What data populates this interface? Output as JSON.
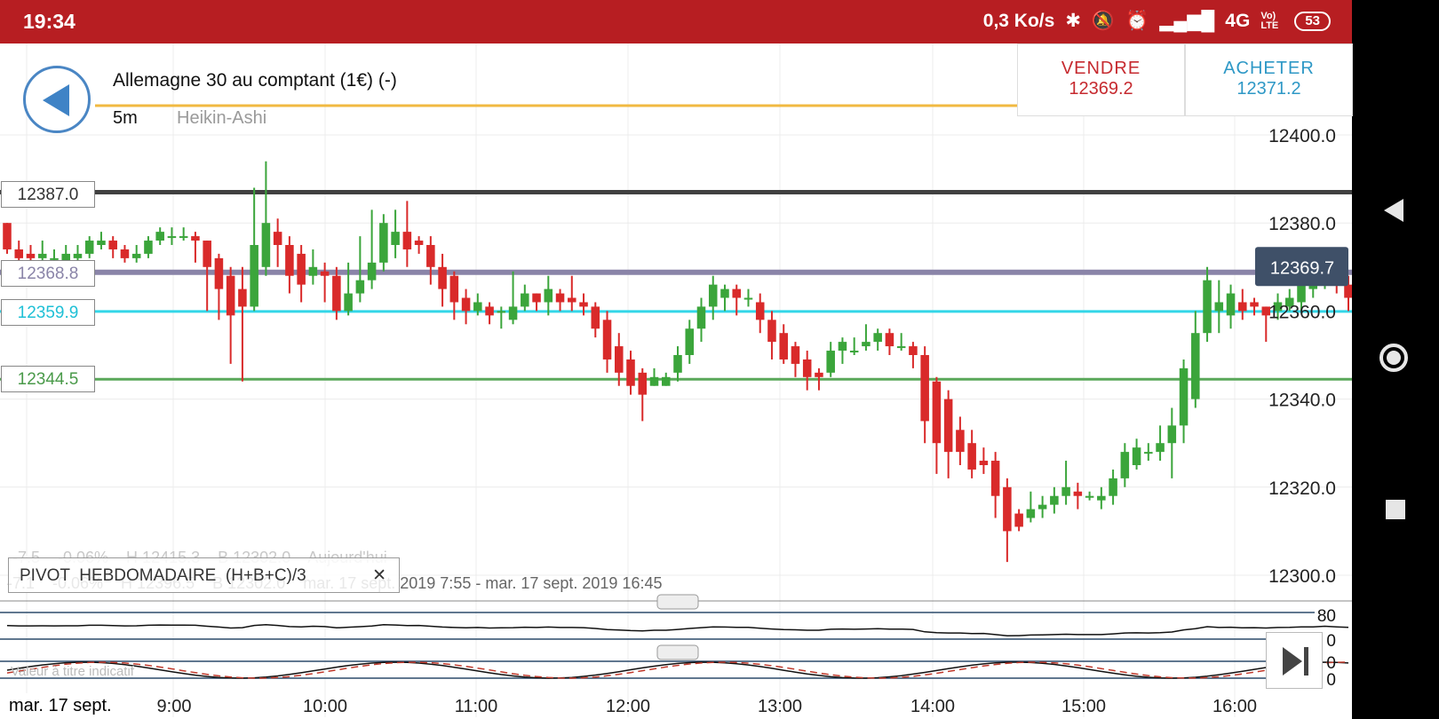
{
  "status_bar": {
    "time": "19:34",
    "net_speed": "0,3 Ko/s",
    "network": "4G",
    "volte": "Vo) LTE",
    "battery": "53"
  },
  "header": {
    "instrument": "Allemagne 30 au comptant (1€) (-)",
    "timeframe": "5m",
    "chart_type": "Heikin-Ashi"
  },
  "trade": {
    "sell_label": "VENDRE",
    "sell_price": "12369.2",
    "buy_label": "ACHETER",
    "buy_price": "12371.2"
  },
  "levels": [
    {
      "label": "12387.0",
      "value": 12387.0,
      "color": "#404040"
    },
    {
      "label": "12368.8",
      "value": 12368.8,
      "color": "#8a84a8"
    },
    {
      "label": "12359.9",
      "value": 12359.9,
      "color": "#33d6e8"
    },
    {
      "label": "12344.5",
      "value": 12344.5,
      "color": "#5aa85a"
    }
  ],
  "current_price": {
    "label": "12369.7",
    "value": 12369.7
  },
  "info_lines": {
    "line1": "-7.5    -0.06%    H 12415.3    B 12302.0    Aujourd'hui",
    "line2": "-7.1    -0.06%    H 12396.5    B 12302.0    mar. 17 sept. 2019 7:55 - mar. 17 sept. 2019 16:45"
  },
  "pivot": {
    "label": "PIVOT  HEBDOMADAIRE  (H+B+C)/3",
    "close_glyph": "✕"
  },
  "indicator_note": "Valeur à titre indicatif",
  "date_label": "mar. 17 sept.",
  "indicator_labels": {
    "rsi_top": "80",
    "rsi_bottom": "0",
    "stoch_top": "0",
    "stoch_bottom": "0"
  },
  "colors": {
    "up": "#3ba53b",
    "down": "#d92a2a",
    "status_bar": "#b71e22",
    "current_price_bg": "#3f5068"
  },
  "chart_data": {
    "type": "candlestick",
    "y_axis": {
      "ticks": [
        12400.0,
        12380.0,
        12360.0,
        12340.0,
        12320.0,
        12300.0
      ],
      "tick_labels": [
        "12400.0",
        "12380.0",
        "12360.0",
        "12340.0",
        "12320.0",
        "12300.0"
      ],
      "range": [
        12290,
        12420
      ]
    },
    "x_axis": {
      "tick_labels": [
        "9:00",
        "10:00",
        "11:00",
        "12:00",
        "13:00",
        "14:00",
        "15:00",
        "16:00"
      ]
    },
    "candles": [
      [
        12380,
        12374,
        12380,
        12373
      ],
      [
        12374,
        12372,
        12376,
        12371
      ],
      [
        12373,
        12372,
        12375,
        12371
      ],
      [
        12372,
        12373,
        12376,
        12371
      ],
      [
        12372,
        12372,
        12374,
        12370
      ],
      [
        12371,
        12373,
        12375,
        12370
      ],
      [
        12372,
        12373,
        12375,
        12371
      ],
      [
        12373,
        12376,
        12377,
        12372
      ],
      [
        12375,
        12376,
        12378,
        12374
      ],
      [
        12376,
        12374,
        12377,
        12372
      ],
      [
        12374,
        12372,
        12375,
        12371
      ],
      [
        12372,
        12373,
        12375,
        12371
      ],
      [
        12373,
        12376,
        12377,
        12372
      ],
      [
        12376,
        12378,
        12379,
        12375
      ],
      [
        12377,
        12377,
        12379,
        12375
      ],
      [
        12377,
        12377,
        12379,
        12376
      ],
      [
        12377,
        12376,
        12378,
        12371
      ],
      [
        12376,
        12370,
        12376,
        12360
      ],
      [
        12372,
        12365,
        12373,
        12358
      ],
      [
        12368,
        12359,
        12370,
        12348
      ],
      [
        12365,
        12361,
        12370,
        12344
      ],
      [
        12361,
        12375,
        12388,
        12360
      ],
      [
        12370,
        12380,
        12394,
        12368
      ],
      [
        12378,
        12375,
        12381,
        12370
      ],
      [
        12375,
        12368,
        12377,
        12364
      ],
      [
        12373,
        12366,
        12375,
        12362
      ],
      [
        12368,
        12370,
        12374,
        12366
      ],
      [
        12369,
        12368,
        12371,
        12362
      ],
      [
        12368,
        12360,
        12370,
        12358
      ],
      [
        12360,
        12364,
        12371,
        12359
      ],
      [
        12364,
        12367,
        12377,
        12362
      ],
      [
        12367,
        12371,
        12383,
        12365
      ],
      [
        12371,
        12380,
        12382,
        12369
      ],
      [
        12375,
        12378,
        12383,
        12372
      ],
      [
        12378,
        12374,
        12385,
        12370
      ],
      [
        12376,
        12375,
        12377,
        12373
      ],
      [
        12375,
        12370,
        12377,
        12366
      ],
      [
        12370,
        12365,
        12373,
        12361
      ],
      [
        12368,
        12362,
        12369,
        12358
      ],
      [
        12363,
        12360,
        12365,
        12357
      ],
      [
        12360,
        12362,
        12364,
        12359
      ],
      [
        12361,
        12359,
        12362,
        12357
      ],
      [
        12360,
        12360,
        12361,
        12356
      ],
      [
        12358,
        12361,
        12369,
        12357
      ],
      [
        12361,
        12364,
        12366,
        12360
      ],
      [
        12364,
        12362,
        12364,
        12360
      ],
      [
        12362,
        12365,
        12368,
        12359
      ],
      [
        12364,
        12362,
        12365,
        12360
      ],
      [
        12363,
        12362,
        12368,
        12360
      ],
      [
        12362,
        12361,
        12364,
        12359
      ],
      [
        12361,
        12356,
        12362,
        12354
      ],
      [
        12358,
        12349,
        12360,
        12346
      ],
      [
        12352,
        12346,
        12355,
        12343
      ],
      [
        12349,
        12343,
        12351,
        12341
      ],
      [
        12346,
        12341,
        12347,
        12335
      ],
      [
        12343,
        12345,
        12347,
        12343
      ],
      [
        12343,
        12345,
        12346,
        12343
      ],
      [
        12346,
        12350,
        12352,
        12344
      ],
      [
        12350,
        12356,
        12358,
        12348
      ],
      [
        12356,
        12361,
        12363,
        12353
      ],
      [
        12361,
        12366,
        12368,
        12358
      ],
      [
        12363,
        12365,
        12366,
        12360
      ],
      [
        12365,
        12363,
        12366,
        12359
      ],
      [
        12363,
        12363,
        12365,
        12361
      ],
      [
        12362,
        12358,
        12364,
        12355
      ],
      [
        12358,
        12353,
        12360,
        12349
      ],
      [
        12355,
        12349,
        12357,
        12348
      ],
      [
        12352,
        12348,
        12353,
        12345
      ],
      [
        12349,
        12345,
        12351,
        12342
      ],
      [
        12346,
        12345,
        12347,
        12342
      ],
      [
        12346,
        12351,
        12353,
        12345
      ],
      [
        12351,
        12353,
        12354,
        12348
      ],
      [
        12351,
        12351,
        12354,
        12350
      ],
      [
        12352,
        12353,
        12357,
        12351
      ],
      [
        12353,
        12355,
        12356,
        12351
      ],
      [
        12355,
        12352,
        12356,
        12350
      ],
      [
        12352,
        12352,
        12355,
        12351
      ],
      [
        12352,
        12350,
        12353,
        12347
      ],
      [
        12350,
        12335,
        12352,
        12330
      ],
      [
        12344,
        12330,
        12345,
        12323
      ],
      [
        12340,
        12328,
        12342,
        12322
      ],
      [
        12333,
        12328,
        12336,
        12325
      ],
      [
        12330,
        12324,
        12333,
        12322
      ],
      [
        12326,
        12325,
        12329,
        12323
      ],
      [
        12326,
        12318,
        12328,
        12313
      ],
      [
        12320,
        12310,
        12322,
        12303
      ],
      [
        12314,
        12311,
        12315,
        12310
      ],
      [
        12313,
        12315,
        12319,
        12312
      ],
      [
        12315,
        12316,
        12318,
        12313
      ],
      [
        12316,
        12318,
        12320,
        12314
      ],
      [
        12318,
        12320,
        12326,
        12316
      ],
      [
        12319,
        12318,
        12321,
        12315
      ],
      [
        12318,
        12318,
        12319,
        12317
      ],
      [
        12317,
        12318,
        12320,
        12315
      ],
      [
        12318,
        12322,
        12324,
        12316
      ],
      [
        12322,
        12328,
        12330,
        12320
      ],
      [
        12325,
        12329,
        12331,
        12324
      ],
      [
        12328,
        12328,
        12330,
        12326
      ],
      [
        12328,
        12330,
        12334,
        12326
      ],
      [
        12330,
        12334,
        12338,
        12322
      ],
      [
        12334,
        12347,
        12349,
        12330
      ],
      [
        12340,
        12355,
        12360,
        12338
      ],
      [
        12355,
        12367,
        12370,
        12353
      ],
      [
        12360,
        12362,
        12367,
        12355
      ],
      [
        12359,
        12364,
        12366,
        12356
      ],
      [
        12362,
        12360,
        12365,
        12358
      ],
      [
        12362,
        12361,
        12363,
        12359
      ],
      [
        12361,
        12359,
        12361,
        12353
      ],
      [
        12360,
        12362,
        12364,
        12358
      ],
      [
        12361,
        12363,
        12365,
        12360
      ],
      [
        12362,
        12366,
        12369,
        12360
      ],
      [
        12365,
        12366,
        12370,
        12363
      ],
      [
        12367,
        12370,
        12372,
        12365
      ],
      [
        12369,
        12366,
        12371,
        12364
      ],
      [
        12366,
        12363,
        12368,
        12360
      ]
    ]
  }
}
